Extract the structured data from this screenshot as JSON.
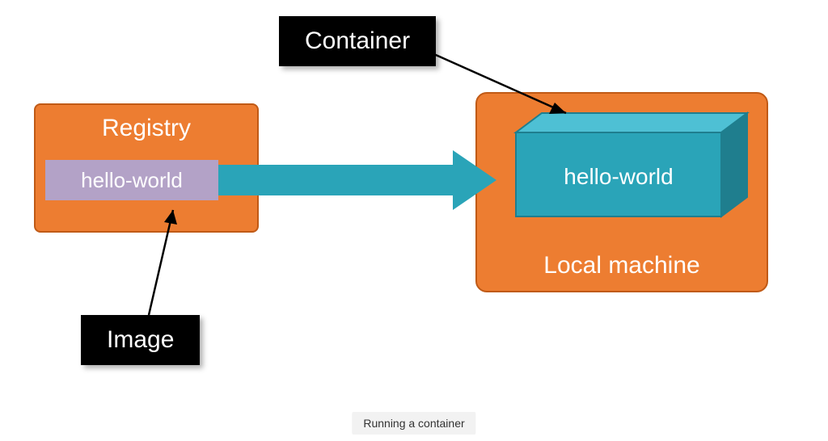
{
  "labels": {
    "container": "Container",
    "image": "Image"
  },
  "registry": {
    "title": "Registry",
    "image_name": "hello-world"
  },
  "local_machine": {
    "title": "Local machine",
    "container_name": "hello-world"
  },
  "caption": "Running a container",
  "colors": {
    "orange": "#ed7d31",
    "orange_border": "#c05a16",
    "teal": "#2aa4b8",
    "teal_dark": "#1f7e8e",
    "teal_light": "#4ec0d4",
    "lavender": "#b3a2c7",
    "black": "#000000",
    "white": "#ffffff"
  }
}
